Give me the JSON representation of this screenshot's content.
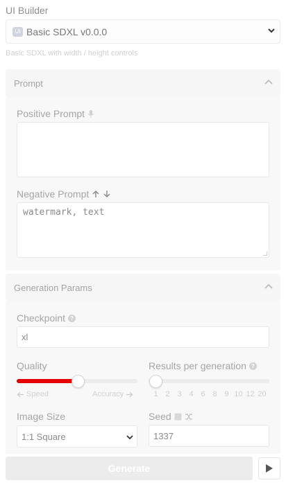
{
  "app": {
    "title": "UI Builder"
  },
  "workflow": {
    "icon_text": "UI",
    "selected": "Basic SDXL v0.0.0",
    "description": "Basic SDXL with width / height controls"
  },
  "sections": {
    "prompt": {
      "title": "Prompt",
      "positive_label": "Positive Prompt",
      "positive_value": "",
      "negative_label": "Negative Prompt",
      "negative_value": "watermark, text"
    },
    "generation": {
      "title": "Generation Params",
      "checkpoint_label": "Checkpoint",
      "checkpoint_value": "xl",
      "quality_label": "Quality",
      "quality_level": 0.51,
      "quality_left_hint": "Speed",
      "quality_right_hint": "Accuracy",
      "results_label": "Results per generation",
      "results_ticks": [
        "1",
        "2",
        "3",
        "4",
        "6",
        "8",
        "9",
        "10",
        "12",
        "20"
      ],
      "results_selected": "1",
      "image_size_label": "Image Size",
      "image_size_value": "1:1 Square",
      "seed_label": "Seed",
      "seed_value": "1337"
    }
  },
  "actions": {
    "generate_label": "Generate"
  },
  "colors": {
    "accent": "#e30000",
    "muted_text": "#a5a5a5",
    "panel_bg": "#f6f6f6"
  }
}
